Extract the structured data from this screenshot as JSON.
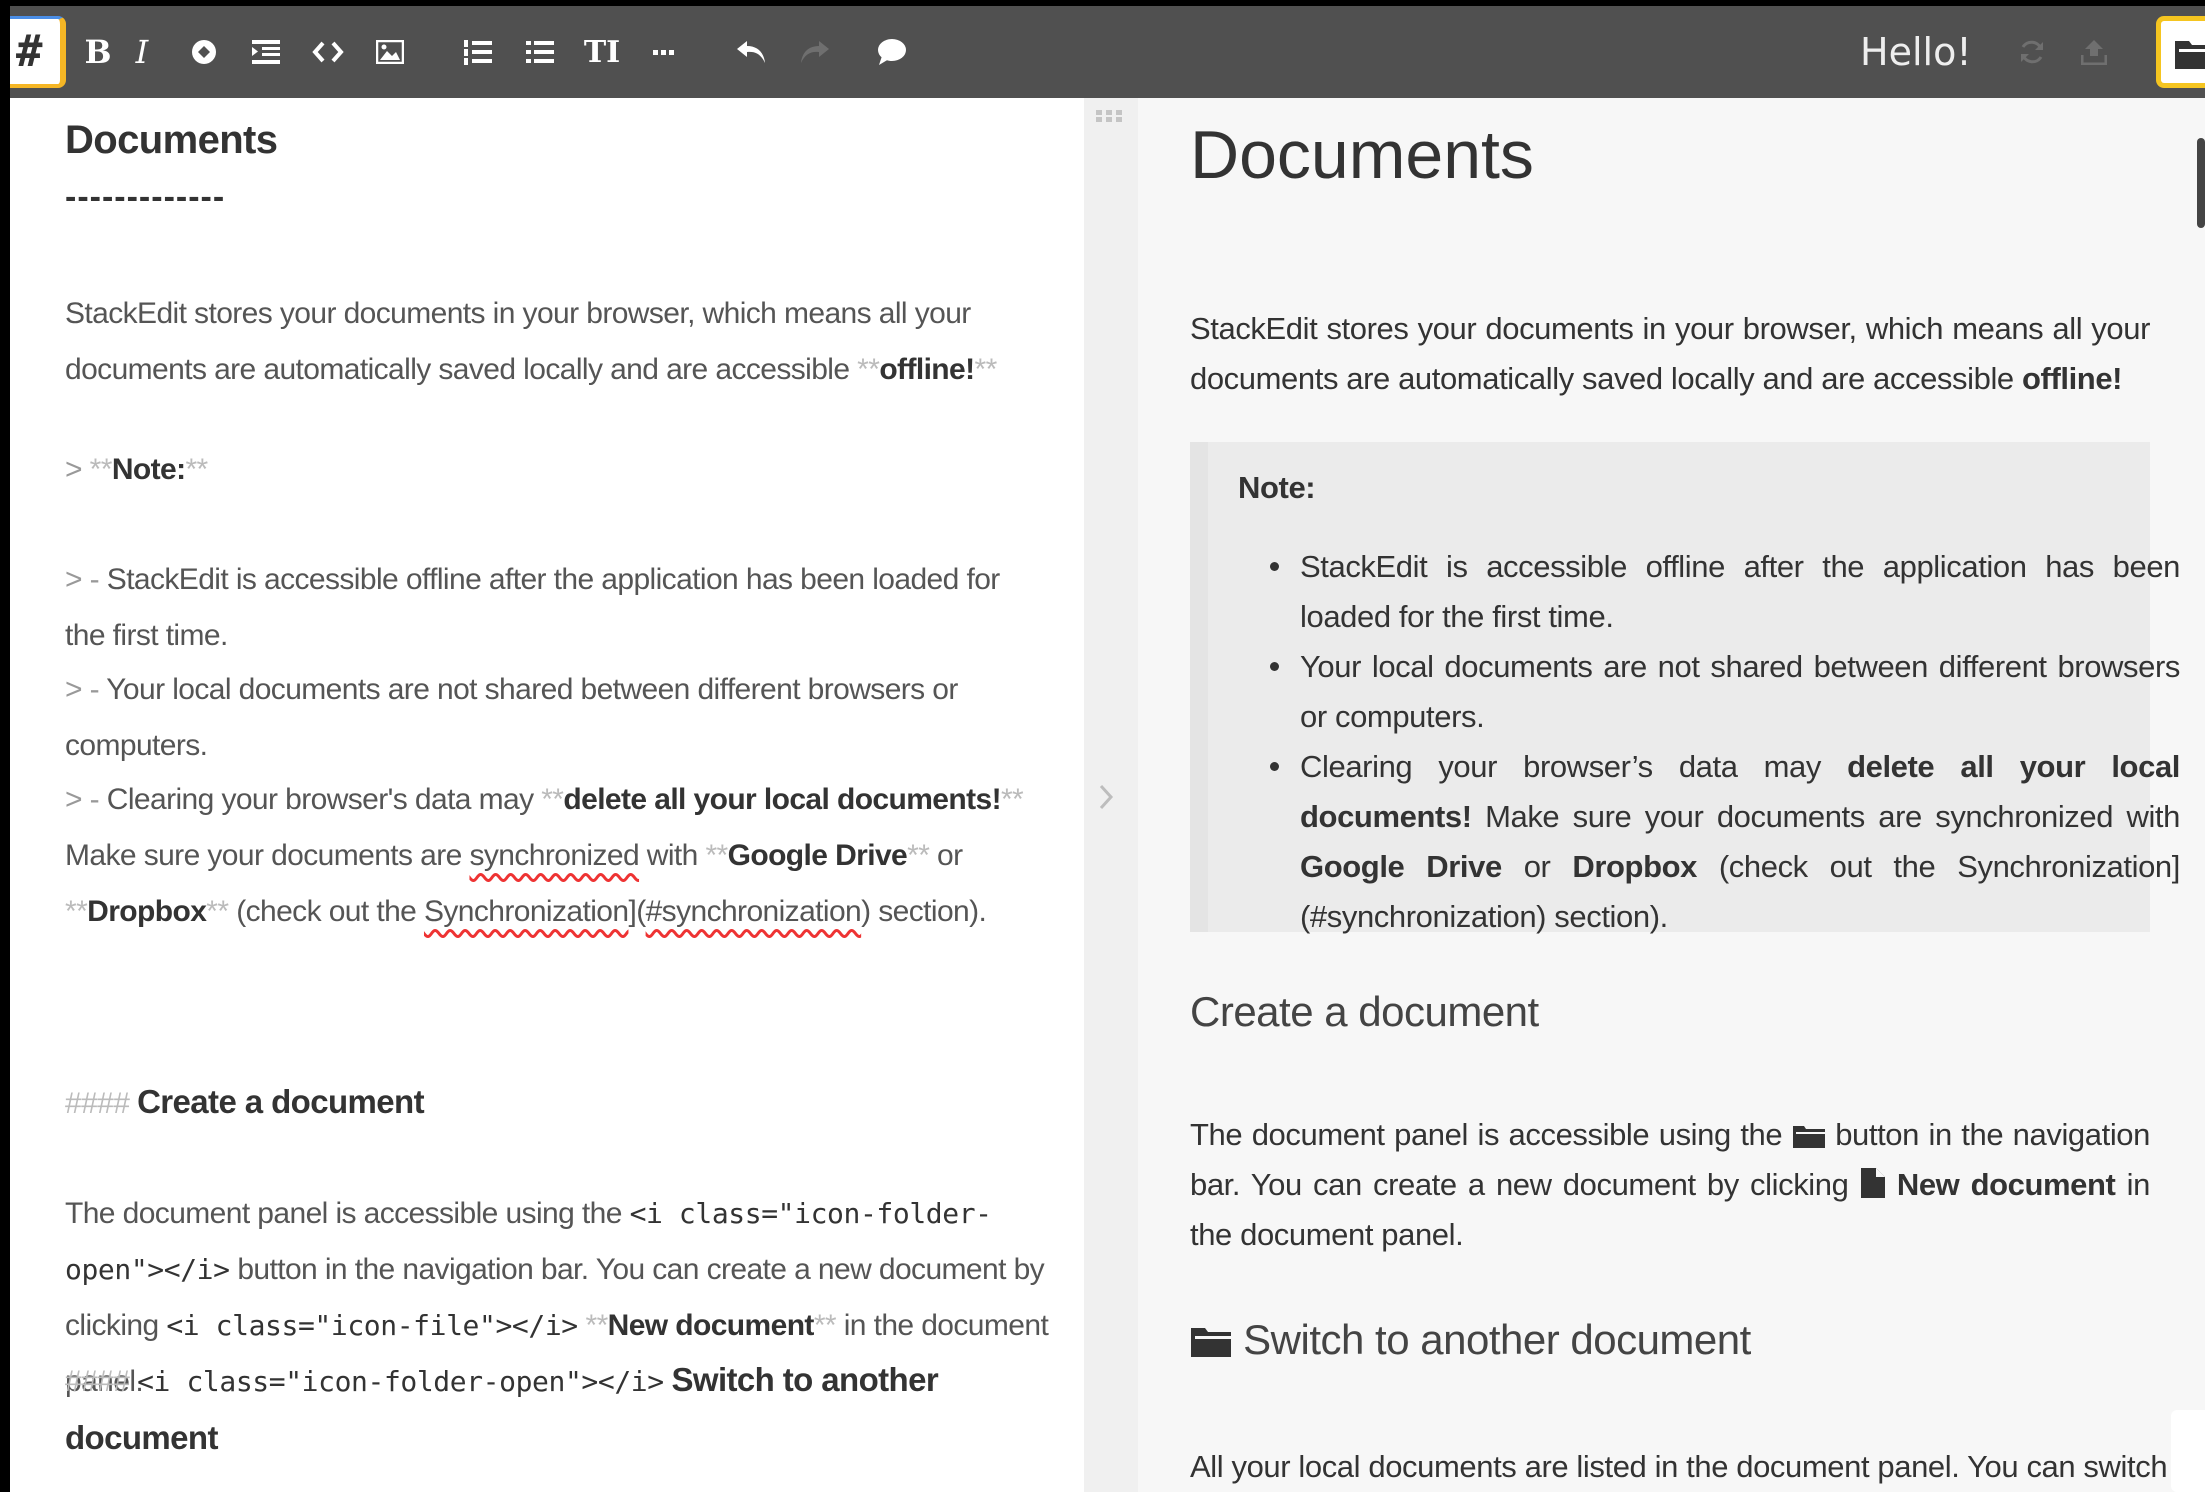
{
  "toolbar": {
    "hash_label": "#",
    "bold_label": "B",
    "italic_label": "I",
    "heading_label": "TI",
    "greeting": "Hello!"
  },
  "editor": {
    "title": "Documents",
    "rule": "-------------",
    "p1_a": "StackEdit stores your documents in your browser, which means all your documents are automatically saved locally and are accessible ",
    "p1_b": "offline!",
    "mk_bold": "**",
    "quote_mark": "> ",
    "quote_item_mark": "> - ",
    "note_label": "Note:",
    "q1": "StackEdit is accessible offline after the application has been loaded for the first time.",
    "q2": "Your local documents are not shared between different browsers or computers.",
    "q3_a": "Clearing your browser's data may ",
    "q3_b": "delete all your local documents!",
    "q3_c": " Make sure your documents are ",
    "q3_sync": "synchronized",
    "q3_d": " with ",
    "q3_gd": "Google Drive",
    "q3_e": " or ",
    "q3_db": "Dropbox",
    "q3_f": "(check out the ",
    "q3_link": "Synchronization",
    "q3_g": "](",
    "q3_anchor": "#synchronization",
    "q3_h": ") section).",
    "h4_mark": "#### ",
    "h4_create": "Create a document",
    "p2_a": "The document panel is accessible using the ",
    "p2_code1": "<i class=\"icon-folder-open\"></i>",
    "p2_b": " button in the navigation bar. You can create a new document by clicking ",
    "p2_code2": "<i class=\"icon-file\"></i>",
    "p2_new": "New document",
    "p2_c": " in the document panel.",
    "h4_code": "<i class=\"icon-folder-open\"></i>",
    "h4_switch": "Switch to another document"
  },
  "preview": {
    "title": "Documents",
    "p1_a": "StackEdit stores your documents in your browser, which means all your documents are automatically saved locally and are accessible ",
    "p1_b": "offline!",
    "note_title": "Note:",
    "li1": "StackEdit is accessible offline after the application has been loaded for the first time.",
    "li2": "Your local documents are not shared between different browsers or computers.",
    "li3_a": "Clearing your browser’s data may ",
    "li3_b": "delete all your local documents!",
    "li3_c": " Make sure your documents are synchronized with ",
    "li3_gd": "Google Drive",
    "li3_d": " or ",
    "li3_db": "Dropbox",
    "li3_e": " (check out the Synchronization](#synchronization) section).",
    "h4_create": "Create a document",
    "p2_a": "The document panel is accessible using the ",
    "p2_b": " button in the navigation bar. You can create a new document by clicking ",
    "p2_new": "New document",
    "p2_c": " in the document panel.",
    "h4_switch": "Switch to another document",
    "p3": "All your local documents are listed in the document panel. You can switch from"
  },
  "colors": {
    "toolbar_bg": "#505050",
    "accent_yellow": "#f5b625",
    "accent_blue": "#4b8ee6"
  },
  "icons": [
    "hash-icon",
    "bold-icon",
    "italic-icon",
    "link-icon",
    "quote-icon",
    "code-icon",
    "image-icon",
    "ordered-list-icon",
    "bullet-list-icon",
    "heading-icon",
    "hr-icon",
    "undo-icon",
    "redo-icon",
    "comment-icon",
    "refresh-icon",
    "upload-icon",
    "folder-open-icon",
    "grip-icon",
    "chevron-right-icon",
    "file-icon"
  ]
}
